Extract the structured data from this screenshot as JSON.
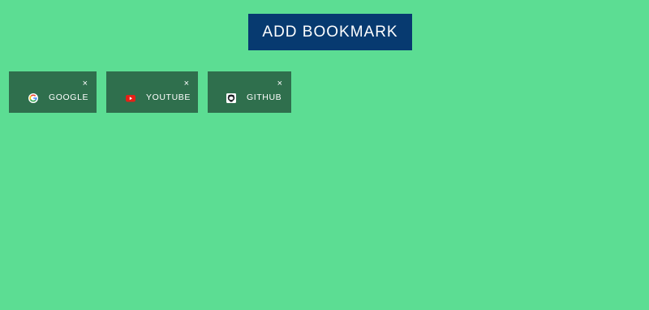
{
  "header": {
    "add_label": "ADD BOOKMARK"
  },
  "bookmarks": [
    {
      "label": "GOOGLE",
      "icon": "google-icon",
      "close": "×"
    },
    {
      "label": "YOUTUBE",
      "icon": "youtube-icon",
      "close": "×"
    },
    {
      "label": "GITHUB",
      "icon": "github-icon",
      "close": "×"
    }
  ],
  "colors": {
    "background": "#5cdd93",
    "button": "#073a70",
    "card": "#2f6f4d"
  }
}
